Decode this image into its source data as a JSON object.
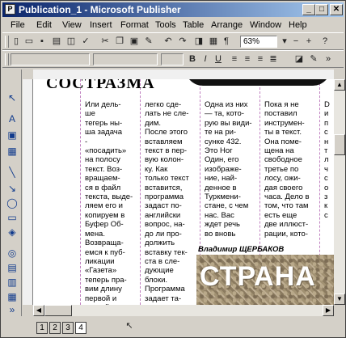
{
  "window": {
    "title": "Publication_1 - Microsoft Publisher",
    "app_icon": "publisher-icon",
    "controls": {
      "minimize": "_",
      "maximize": "□",
      "close": "✕"
    }
  },
  "menu": [
    "File",
    "Edit",
    "View",
    "Insert",
    "Format",
    "Tools",
    "Table",
    "Arrange",
    "Window",
    "Help"
  ],
  "toolbar": {
    "zoom": "63%",
    "zoom_out": "−",
    "zoom_in": "+"
  },
  "document": {
    "heading": "СОСТРАЗМА",
    "columns": [
      "Или дель-\nше\nтегерь ны-\nша задача\n-\n«посадить»\nна полосу\nтекст. Воз-\nвращаем-\nся в файл\nтекста, выде-\nляем его и\nкопируем в\nБуфер Об-\nмена.\nВозвраща-\nемся к пуб-\nликации\n«Газета»\nтеперь пра-\nвим длину\nпервой и\nвторой ко-",
      "легко сде-\nлать не сле-\nдим.\nПосле этого\nвставляем\nтекст в пер-\nвую колон-\nку. Как\nтолько текст\nвставится,\nпрограмма\nзадаст по-\nанглийски\nвопрос, на-\nдо ли про-\nдолжить\nвставку тек-\nста в сле-\nдующие\nблоки.\nПрограмма\nзадает та-\nкие вопросы",
      "Одна из них\n— та, кото-\nрую вы види-\nте на ри-\nсунке 432.\nЭто Ног\nОдин, его\nизображе-\nние, най-\nденное в\nТуркмени-\nстане, с чем\nнас. Вас\nждет речь\nво вновь",
      "Пока я не\nпоставил\nинструмен-\nты в текст.\nОна поме-\nщена на\nсвободное\nтретье по\nлосу, ожи-\nдая своего\nчаса. Дело в\nтом, что там\nесть еще\nдве иллюст-\nрации, кото-",
      "D\nи\nп\nс\nн\nт\nл\nч\nс\nо\nз\nк\nс"
    ],
    "byline": "Владимир ЩЕРБАКОВ",
    "photo_caption": "СТРАНА"
  },
  "pages": [
    "1",
    "2",
    "3",
    "4"
  ],
  "colors": {
    "title_start": "#0a246a",
    "title_end": "#a6caf0",
    "chrome": "#d4d0c8"
  }
}
